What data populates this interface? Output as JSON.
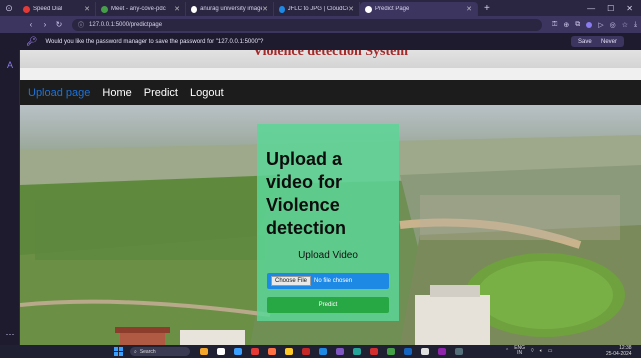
{
  "browser": {
    "tabs": [
      {
        "label": "Speed Dial",
        "icon_color": "#e53935",
        "active": false
      },
      {
        "label": "Meet - any-cove-pdc",
        "icon_color": "#43a047",
        "active": false
      },
      {
        "label": "anurag university image sc",
        "icon_color": "#ffffff",
        "active": false
      },
      {
        "label": "JFLC to JPG | CloudConvert",
        "icon_color": "#1e88e5",
        "active": false
      },
      {
        "label": "Predict Page",
        "icon_color": "#ffffff",
        "active": true
      }
    ],
    "url": "127.0.0.1:5000/predictpage",
    "password_prompt": "Would you like the password manager to save the password for \"127.0.0.1:5000\"?",
    "save_label": "Save",
    "never_label": "Never"
  },
  "page": {
    "site_title": "Violence detection System",
    "nav": [
      {
        "label": "Upload page",
        "active": true
      },
      {
        "label": "Home",
        "active": false
      },
      {
        "label": "Predict",
        "active": false
      },
      {
        "label": "Logout",
        "active": false
      }
    ],
    "card": {
      "title": "Upload a video for Violence detection",
      "subtitle": "Upload Video",
      "file_button": "Choose File",
      "file_status": "No file chosen",
      "submit_label": "Predict"
    }
  },
  "taskbar": {
    "search_placeholder": "Search",
    "language": "ENG",
    "language_region": "IN",
    "time": "12:38",
    "date": "25-04-2024"
  },
  "colors": {
    "accent_link": "#1e73d9",
    "card_bg": "#5cd696",
    "file_input": "#1e88e5",
    "predict_button": "#28a745",
    "title_text": "#a52a2a"
  }
}
